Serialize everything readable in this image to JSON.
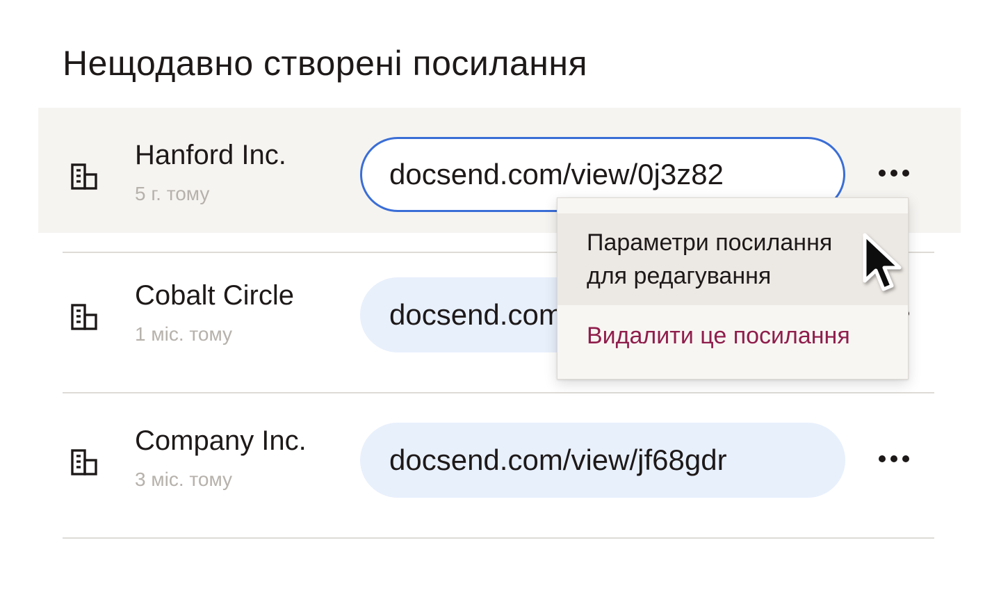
{
  "heading": "Нещодавно створені посилання",
  "links": [
    {
      "name": "Hanford Inc.",
      "time": "5 г. тому",
      "url": "docsend.com/view/0j3z82",
      "icon": "building-icon"
    },
    {
      "name": "Cobalt Circle",
      "time": "1 міс. тому",
      "url": "docsend.com/view/",
      "icon": "building-icon"
    },
    {
      "name": "Company Inc.",
      "time": "3 міс. тому",
      "url": "docsend.com/view/jf68gdr",
      "icon": "building-icon"
    }
  ],
  "menu": {
    "edit_label_line1": "Параметри посилання",
    "edit_label_line2": "для редагування",
    "delete_label": "Видалити це посилання"
  },
  "colors": {
    "active_border": "#3a6ed6",
    "pill_background": "#e8f0fc",
    "delete_text": "#8f1e4c",
    "row_highlight": "#f6f4f1",
    "muted_text": "#b6b1ab"
  }
}
